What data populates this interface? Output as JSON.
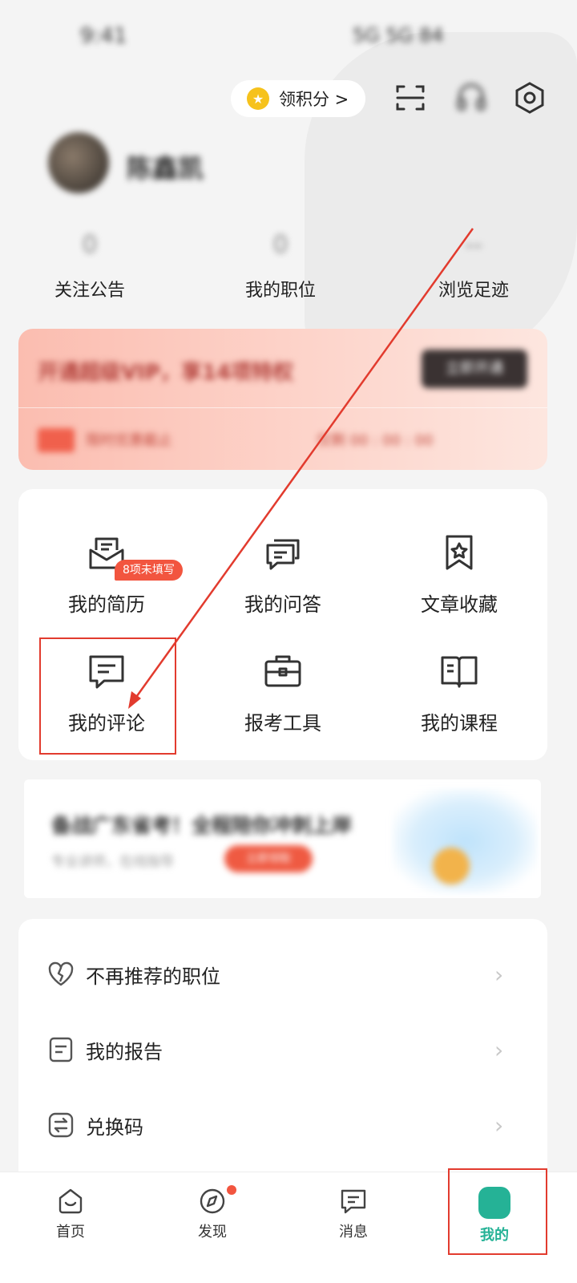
{
  "status": {
    "time": "9:41",
    "indicators": "5G 5G 84"
  },
  "top": {
    "points_label": "领积分 >",
    "icons": [
      "coin-icon",
      "scan-icon",
      "headset-icon",
      "settings-icon"
    ]
  },
  "profile": {
    "name": "陈鑫凯"
  },
  "stats": [
    {
      "value": "0",
      "label": "关注公告"
    },
    {
      "value": "0",
      "label": "我的职位"
    },
    {
      "value": "--",
      "label": "浏览足迹"
    }
  ],
  "vip": {
    "title": "开通超级VIP，享14项特权",
    "button": "立即开通",
    "subtitle": "限时优惠截止",
    "countdown": "仅剩 00 : 00 : 00"
  },
  "grid": {
    "badge": "8项未填写",
    "items": [
      {
        "label": "我的简历",
        "icon": "resume-icon"
      },
      {
        "label": "我的问答",
        "icon": "qa-icon"
      },
      {
        "label": "文章收藏",
        "icon": "bookmark-icon"
      },
      {
        "label": "我的评论",
        "icon": "comment-icon"
      },
      {
        "label": "报考工具",
        "icon": "toolbox-icon"
      },
      {
        "label": "我的课程",
        "icon": "book-icon"
      }
    ]
  },
  "ad": {
    "title": "备战广东省考！全程陪你冲刺上岸",
    "subtitle": "专业讲师，在线指导",
    "button": "立即领取"
  },
  "list": [
    {
      "label": "不再推荐的职位",
      "icon": "broken-heart-icon"
    },
    {
      "label": "我的报告",
      "icon": "report-icon"
    },
    {
      "label": "兑换码",
      "icon": "exchange-icon"
    }
  ],
  "tabs": [
    {
      "label": "首页",
      "icon": "home-icon"
    },
    {
      "label": "发现",
      "icon": "compass-icon"
    },
    {
      "label": "消息",
      "icon": "message-icon"
    },
    {
      "label": "我的",
      "icon": "profile-icon"
    }
  ],
  "colors": {
    "accent": "#25b296",
    "badge": "#f2553f",
    "annotation": "#e23b2e"
  }
}
